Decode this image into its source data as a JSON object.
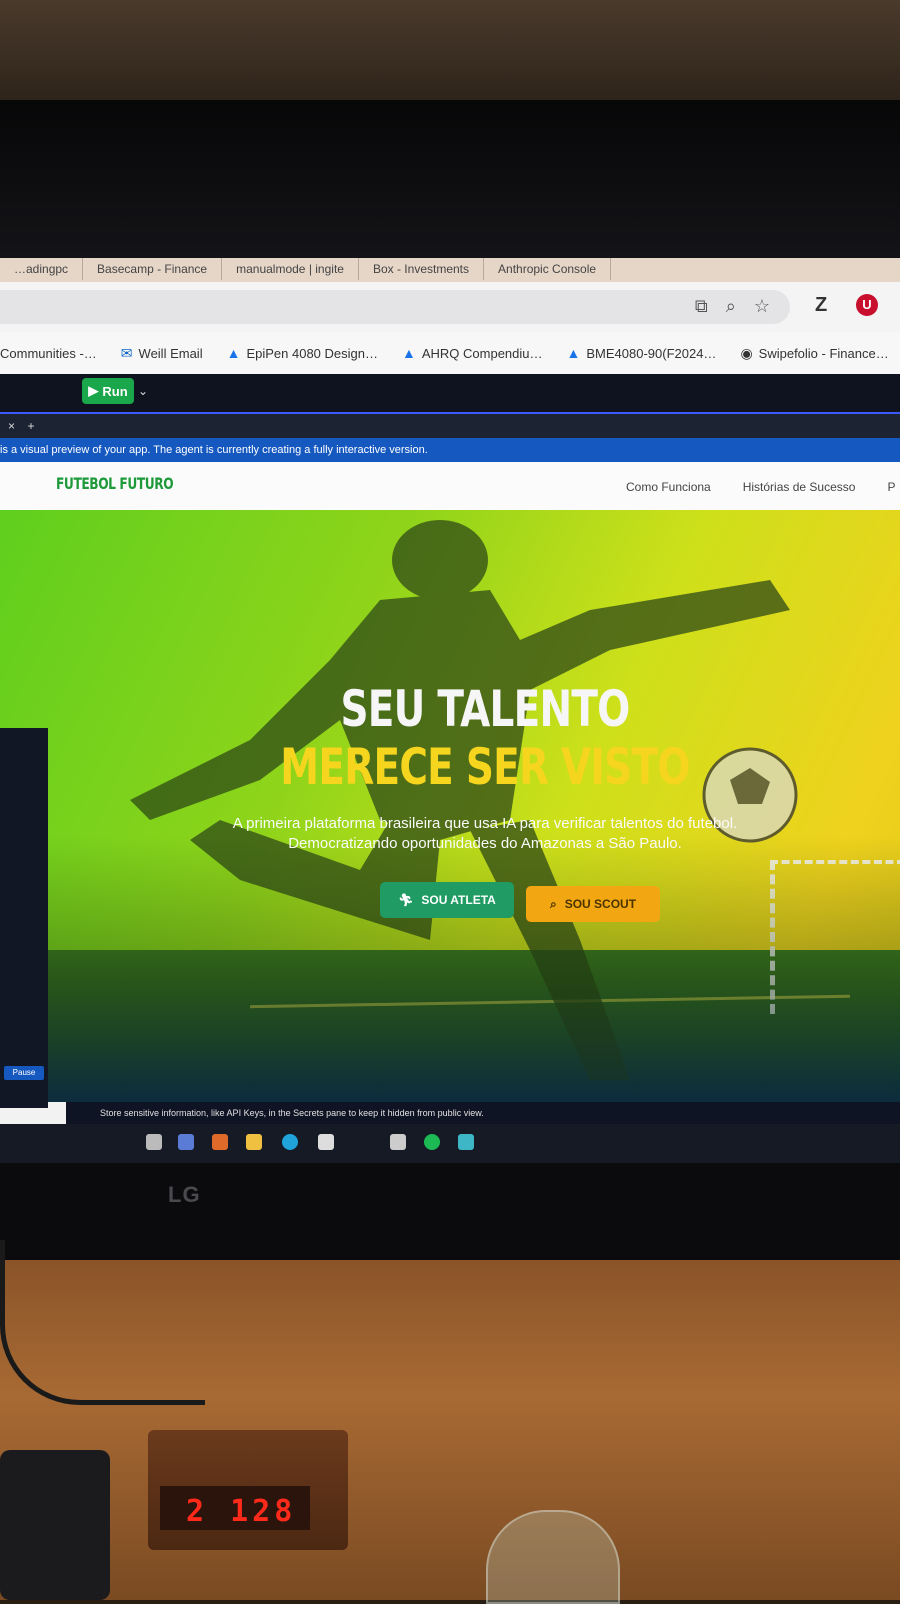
{
  "browser": {
    "tabs": [
      "…adingpc",
      "Basecamp - Finance",
      "manualmode | ingite",
      "Box - Investments",
      "Anthropic Console"
    ],
    "bookmarks": [
      {
        "label": "Communities -…",
        "icon": "group-icon"
      },
      {
        "label": "Weill Email",
        "icon": "outlook-icon"
      },
      {
        "label": "EpiPen 4080 Design…",
        "icon": "drive-icon"
      },
      {
        "label": "AHRQ Compendiu…",
        "icon": "drive-icon"
      },
      {
        "label": "BME4080-90(F2024…",
        "icon": "drive-icon"
      },
      {
        "label": "Swipefolio - Finance…",
        "icon": "globe-icon"
      }
    ],
    "extension_z": "Z",
    "extension_u": "U"
  },
  "replit": {
    "run_label": "Run",
    "tab_icons": [
      "×",
      "+"
    ],
    "preview_banner": "is a visual preview of your app. The agent is currently creating a fully interactive version.",
    "pause_label": "Pause",
    "secrets_tip": "Store sensitive information, like API Keys, in the  Secrets pane to keep it hidden from public view."
  },
  "site": {
    "logo": "FUTEBOL FUTURO",
    "nav": [
      "Como Funciona",
      "Histórias de Sucesso",
      "P"
    ],
    "hero": {
      "headline_1": "SEU TALENTO",
      "headline_2": "MERECE SER VISTO",
      "subtitle": "A primeira plataforma brasileira que usa IA para verificar talentos do futebol. Democratizando oportunidades do Amazonas a São Paulo.",
      "cta_athlete": "SOU ATLETA",
      "cta_scout": "SOU SCOUT"
    }
  },
  "monitor": {
    "brand": "LG"
  },
  "desk_clock": {
    "display": "2 128"
  },
  "colors": {
    "brand_green": "#1e9a3a",
    "headline_yellow": "#f5d51e",
    "cta_green": "#1f9b63",
    "cta_yellow": "#f2a712",
    "replit_run": "#1aa64a",
    "preview_blue": "#1558c0"
  }
}
